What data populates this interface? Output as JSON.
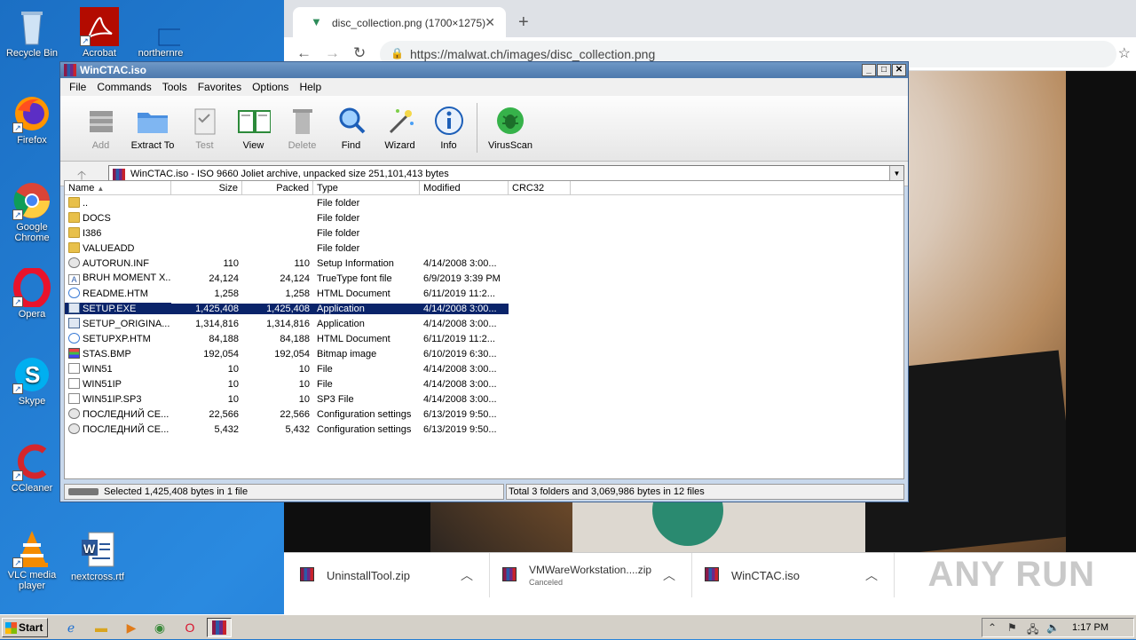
{
  "desktop": {
    "icons": [
      {
        "label": "Recycle Bin"
      },
      {
        "label": "Acrobat"
      },
      {
        "label": "northernre"
      },
      {
        "label": "Firefox"
      },
      {
        "label": "Google Chrome"
      },
      {
        "label": "Opera"
      },
      {
        "label": "Skype"
      },
      {
        "label": "CCleaner"
      },
      {
        "label": "VLC media player"
      },
      {
        "label": "nextcross.rtf"
      }
    ]
  },
  "browser": {
    "tab_title": "disc_collection.png (1700×1275)",
    "url": "https://malwat.ch/images/disc_collection.png",
    "downloads": [
      {
        "name": "UninstallTool.zip",
        "status": ""
      },
      {
        "name": "VMWareWorkstation....zip",
        "status": "Canceled"
      },
      {
        "name": "WinCTAC.iso",
        "status": ""
      }
    ],
    "watermark": "ANY RUN"
  },
  "winrar": {
    "title": "WinCTAC.iso",
    "menu": [
      "File",
      "Commands",
      "Tools",
      "Favorites",
      "Options",
      "Help"
    ],
    "toolbar": [
      {
        "label": "Add",
        "icon": "add-archive-icon",
        "enabled": false
      },
      {
        "label": "Extract To",
        "icon": "extract-folder-icon",
        "enabled": true
      },
      {
        "label": "Test",
        "icon": "test-clipboard-icon",
        "enabled": false
      },
      {
        "label": "View",
        "icon": "view-book-icon",
        "enabled": true
      },
      {
        "label": "Delete",
        "icon": "delete-trash-icon",
        "enabled": false
      },
      {
        "label": "Find",
        "icon": "find-magnifier-icon",
        "enabled": true
      },
      {
        "label": "Wizard",
        "icon": "wizard-wand-icon",
        "enabled": true
      },
      {
        "label": "Info",
        "icon": "info-icon",
        "enabled": true
      },
      {
        "label": "VirusScan",
        "icon": "virusscan-bug-icon",
        "enabled": true
      }
    ],
    "address": "WinCTAC.iso - ISO 9660 Joliet archive, unpacked size 251,101,413 bytes",
    "columns": {
      "name": "Name",
      "size": "Size",
      "packed": "Packed",
      "type": "Type",
      "modified": "Modified",
      "crc": "CRC32"
    },
    "files": [
      {
        "name": "..",
        "size": "",
        "packed": "",
        "type": "File folder",
        "modified": "",
        "icon": "folder"
      },
      {
        "name": "DOCS",
        "size": "",
        "packed": "",
        "type": "File folder",
        "modified": "",
        "icon": "folder"
      },
      {
        "name": "I386",
        "size": "",
        "packed": "",
        "type": "File folder",
        "modified": "",
        "icon": "folder"
      },
      {
        "name": "VALUEADD",
        "size": "",
        "packed": "",
        "type": "File folder",
        "modified": "",
        "icon": "folder"
      },
      {
        "name": "AUTORUN.INF",
        "size": "110",
        "packed": "110",
        "type": "Setup Information",
        "modified": "4/14/2008 3:00...",
        "icon": "cfg"
      },
      {
        "name": "BRUH MOMENT X...",
        "size": "24,124",
        "packed": "24,124",
        "type": "TrueType font file",
        "modified": "6/9/2019 3:39 PM",
        "icon": "font"
      },
      {
        "name": "README.HTM",
        "size": "1,258",
        "packed": "1,258",
        "type": "HTML Document",
        "modified": "6/11/2019 11:2...",
        "icon": "ie"
      },
      {
        "name": "SETUP.EXE",
        "size": "1,425,408",
        "packed": "1,425,408",
        "type": "Application",
        "modified": "4/14/2008 3:00...",
        "icon": "exe",
        "selected": true
      },
      {
        "name": "SETUP_ORIGINA...",
        "size": "1,314,816",
        "packed": "1,314,816",
        "type": "Application",
        "modified": "4/14/2008 3:00...",
        "icon": "exe"
      },
      {
        "name": "SETUPXP.HTM",
        "size": "84,188",
        "packed": "84,188",
        "type": "HTML Document",
        "modified": "6/11/2019 11:2...",
        "icon": "ie"
      },
      {
        "name": "STAS.BMP",
        "size": "192,054",
        "packed": "192,054",
        "type": "Bitmap image",
        "modified": "6/10/2019 6:30...",
        "icon": "bmp"
      },
      {
        "name": "WIN51",
        "size": "10",
        "packed": "10",
        "type": "File",
        "modified": "4/14/2008 3:00...",
        "icon": "doc"
      },
      {
        "name": "WIN51IP",
        "size": "10",
        "packed": "10",
        "type": "File",
        "modified": "4/14/2008 3:00...",
        "icon": "doc"
      },
      {
        "name": "WIN51IP.SP3",
        "size": "10",
        "packed": "10",
        "type": "SP3 File",
        "modified": "4/14/2008 3:00...",
        "icon": "doc"
      },
      {
        "name": "ПОСЛЕДНИЙ СЕ...",
        "size": "22,566",
        "packed": "22,566",
        "type": "Configuration settings",
        "modified": "6/13/2019 9:50...",
        "icon": "cfg"
      },
      {
        "name": "ПОСЛЕДНИЙ СЕ...",
        "size": "5,432",
        "packed": "5,432",
        "type": "Configuration settings",
        "modified": "6/13/2019 9:50...",
        "icon": "cfg"
      }
    ],
    "status_left": "Selected 1,425,408 bytes in 1 file",
    "status_right": "Total 3 folders and 3,069,986 bytes in 12 files"
  },
  "taskbar": {
    "start_label": "Start",
    "clock": "1:17 PM"
  }
}
